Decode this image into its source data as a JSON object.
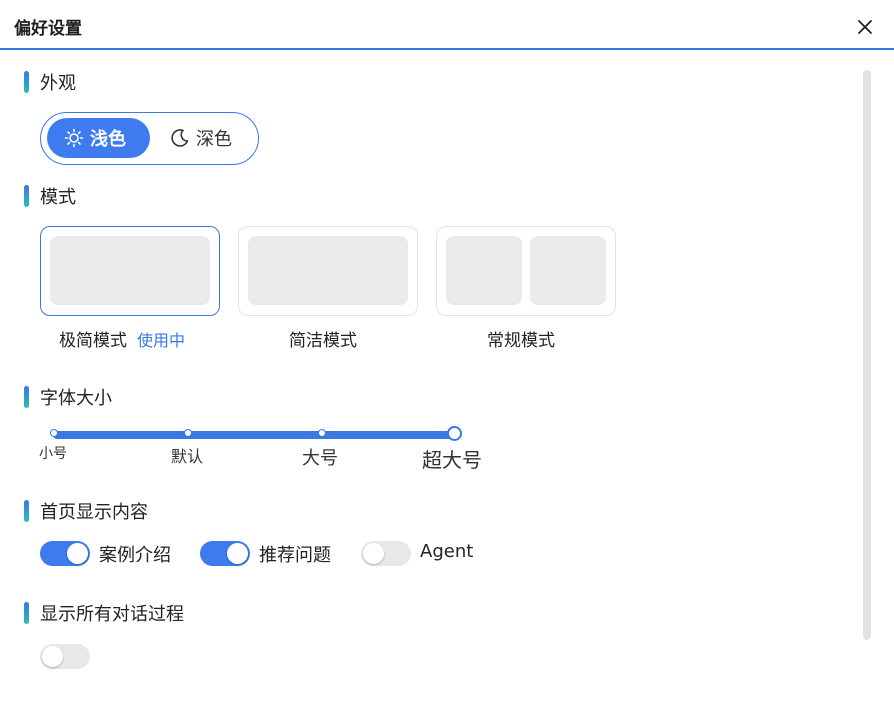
{
  "dialog": {
    "title": "偏好设置",
    "close_icon": "close-icon"
  },
  "appearance": {
    "section_label": "外观",
    "options": [
      {
        "label": "浅色",
        "icon": "sun-icon",
        "selected": true
      },
      {
        "label": "深色",
        "icon": "moon-icon",
        "selected": false
      }
    ]
  },
  "mode": {
    "section_label": "模式",
    "cards": [
      {
        "label": "极简模式",
        "badge": "使用中",
        "active": true
      },
      {
        "label": "简洁模式",
        "active": false
      },
      {
        "label": "常规模式",
        "active": false
      }
    ]
  },
  "font_size": {
    "section_label": "字体大小",
    "ticks": [
      "小号",
      "默认",
      "大号",
      "超大号"
    ],
    "selected": "超大号"
  },
  "homepage": {
    "section_label": "首页显示内容",
    "toggles": [
      {
        "label": "案例介绍",
        "on": true
      },
      {
        "label": "推荐问题",
        "on": true
      },
      {
        "label": "Agent",
        "on": false
      }
    ]
  },
  "show_all": {
    "section_label": "显示所有对话过程",
    "on": false
  },
  "colors": {
    "accent": "#3a78e6",
    "toggle_on": "#3d7bef",
    "toggle_off": "#e8e8e8",
    "placeholder": "#ebebeb"
  }
}
